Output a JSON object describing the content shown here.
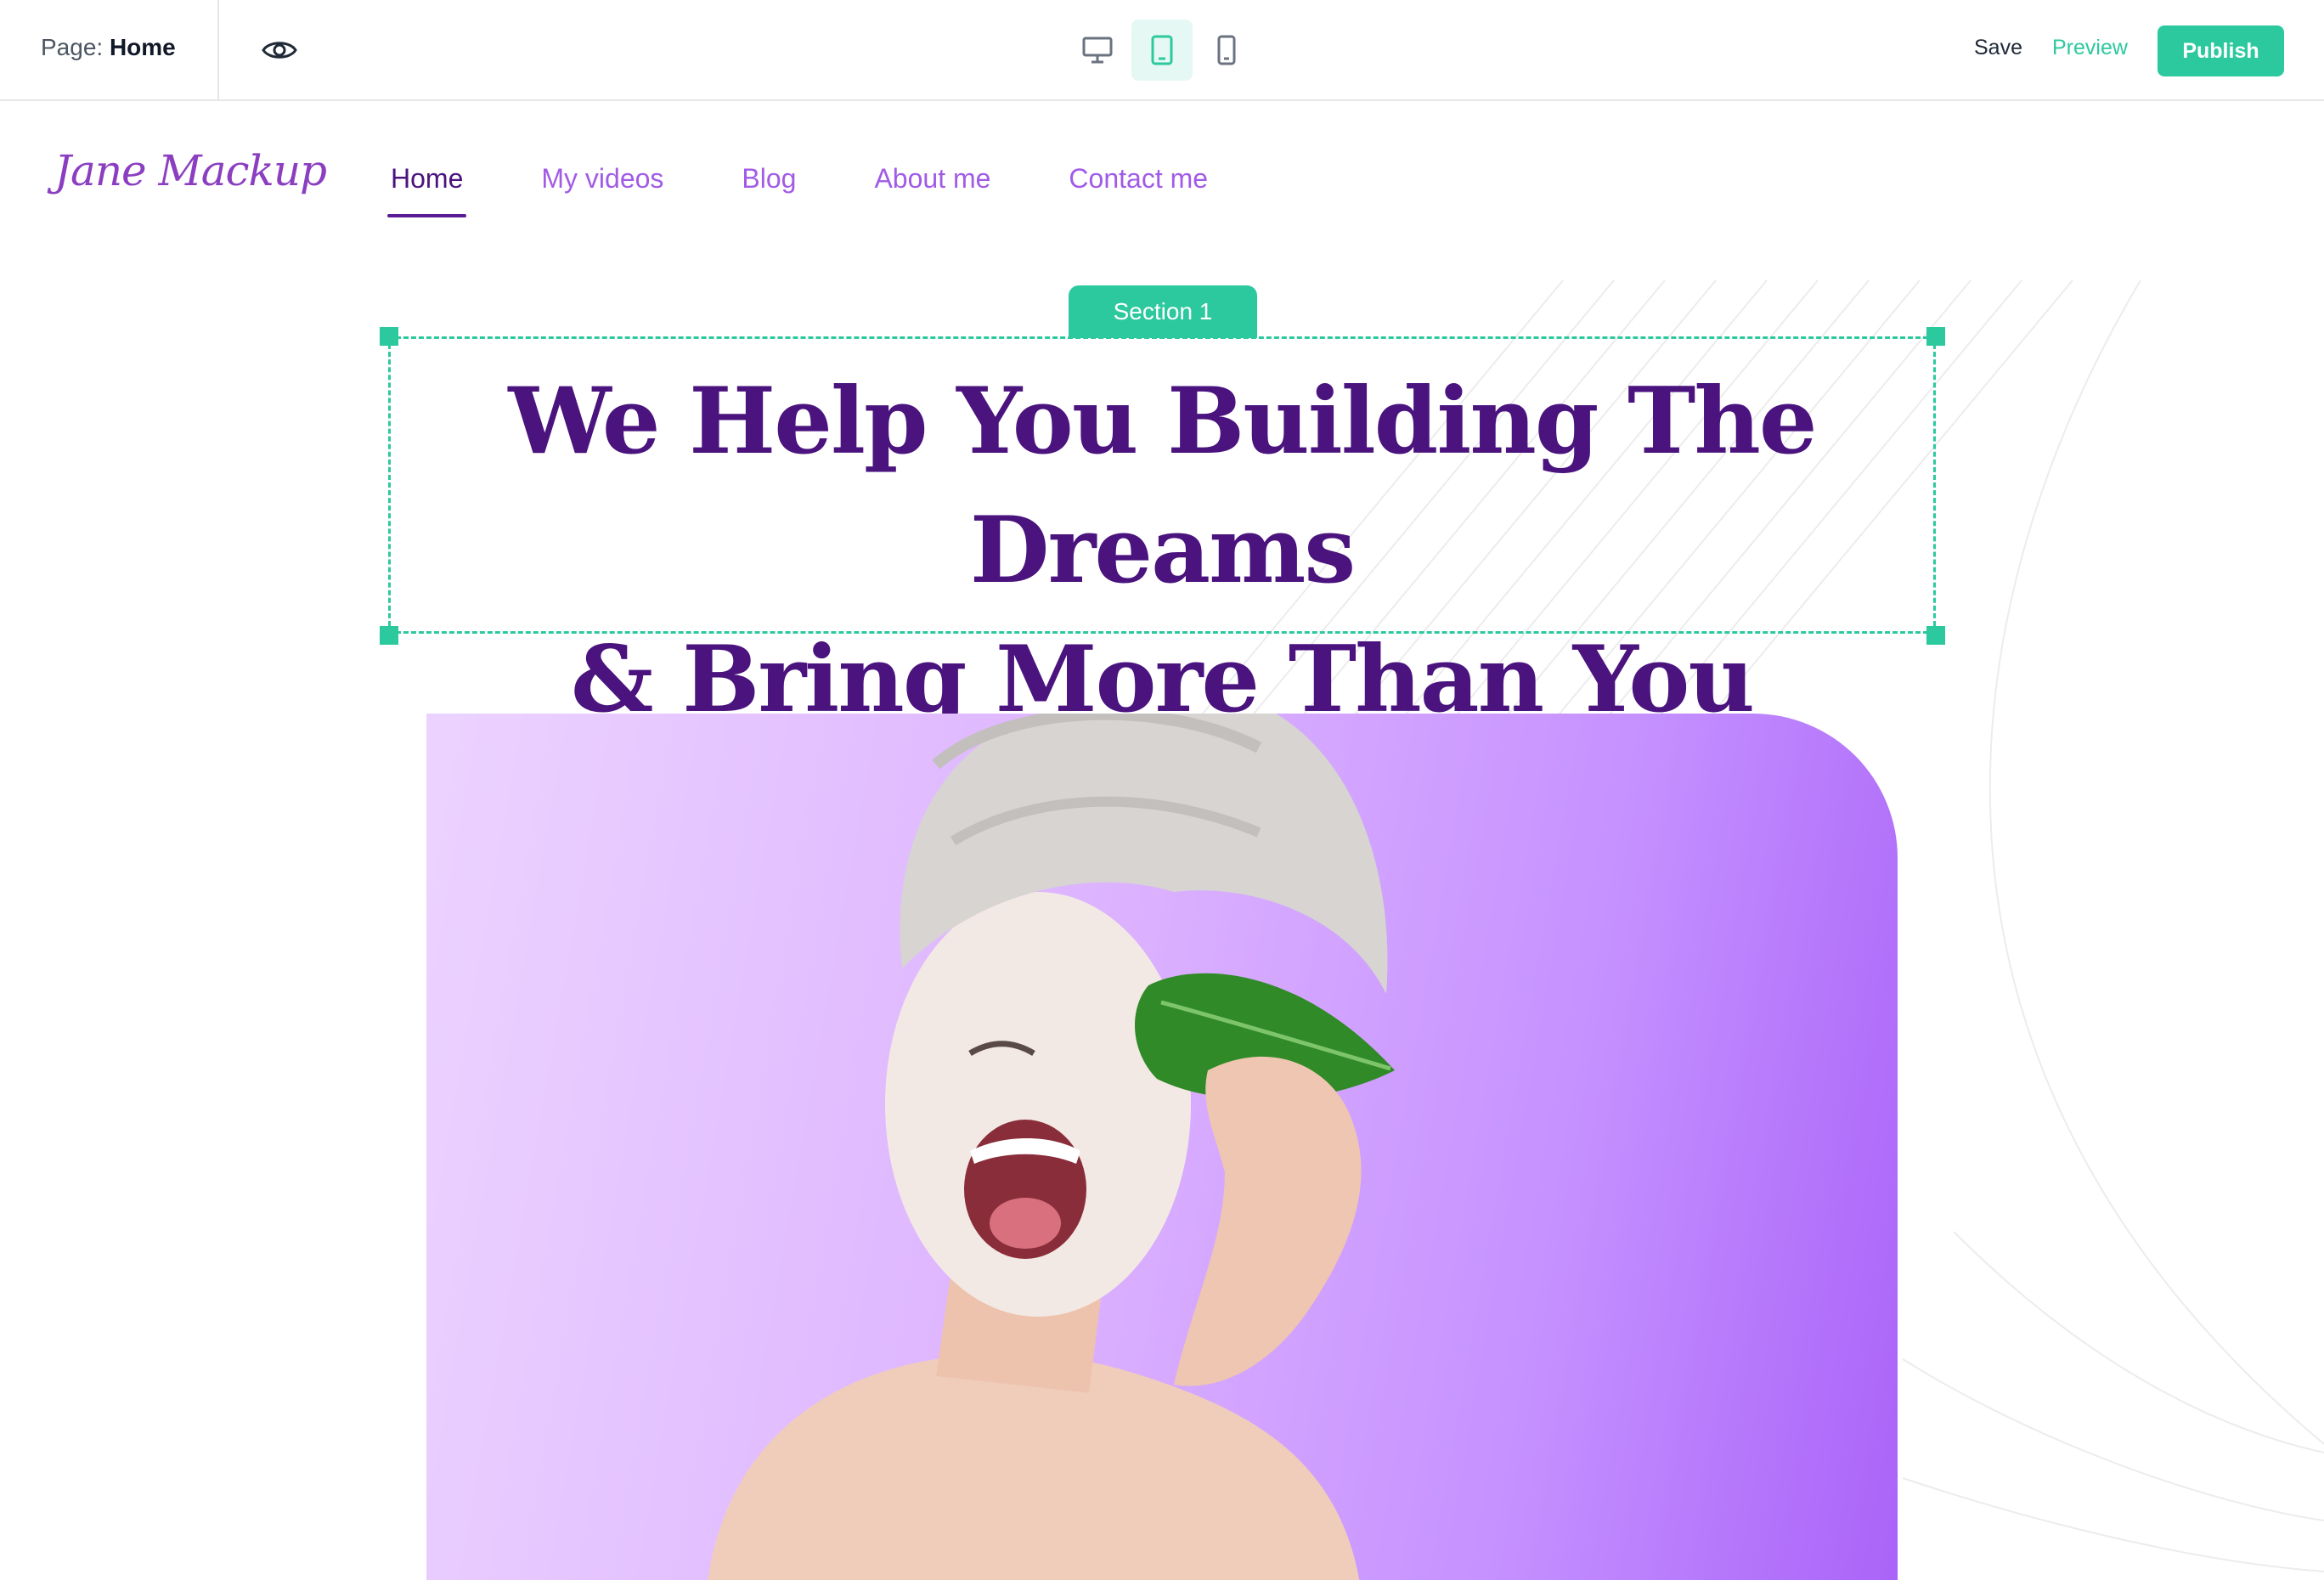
{
  "editor": {
    "page_label": "Page:",
    "page_name": "Home",
    "eye_icon": "eye-icon",
    "devices": [
      {
        "name": "desktop",
        "icon": "monitor-icon",
        "active": false
      },
      {
        "name": "tablet",
        "icon": "tablet-icon",
        "active": true
      },
      {
        "name": "mobile",
        "icon": "smartphone-icon",
        "active": false
      }
    ],
    "save_label": "Save",
    "preview_label": "Preview",
    "publish_label": "Publish"
  },
  "site": {
    "logo_text": "Jane Mackup",
    "nav": [
      {
        "label": "Home",
        "active": true
      },
      {
        "label": "My videos",
        "active": false
      },
      {
        "label": "Blog",
        "active": false
      },
      {
        "label": "About me",
        "active": false
      },
      {
        "label": "Contact me",
        "active": false
      }
    ],
    "section_label": "Section 1",
    "hero_title_line1": "We Help You Building The Dreams",
    "hero_title_line2": "& Bring More Than You Expect"
  },
  "colors": {
    "accent": "#2cc99e",
    "title": "#4a137e",
    "nav": "#a15be6",
    "image_bg": "#c591ff"
  }
}
